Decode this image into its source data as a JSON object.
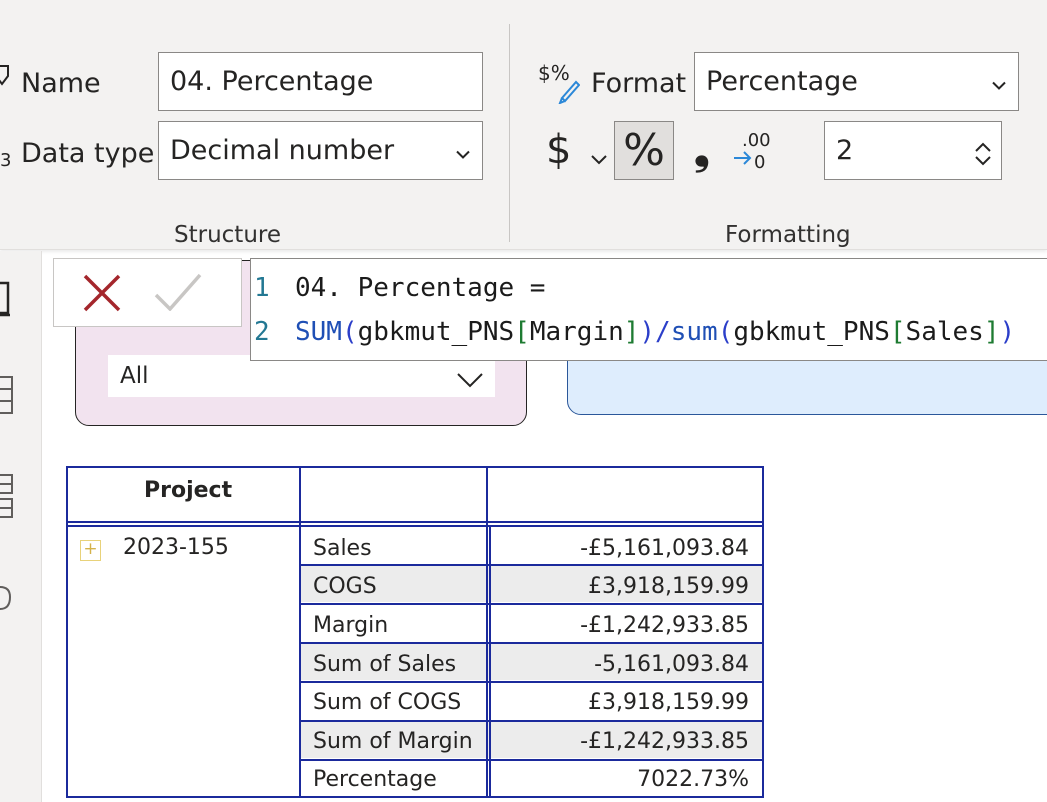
{
  "ribbon": {
    "structure": {
      "name_label": "Name",
      "name_value": "04. Percentage",
      "datatype_label": "Data type",
      "datatype_value": "Decimal number",
      "group_label": "Structure",
      "datatype_icon_glyph": "3"
    },
    "formatting": {
      "format_icon": "$%",
      "format_label": "Format",
      "format_value": "Percentage",
      "currency_symbol": "$",
      "percent_symbol": "%",
      "comma_symbol": "❟",
      "decimal_places": "2",
      "group_label": "Formatting"
    }
  },
  "slicer": {
    "selected_value": "All"
  },
  "formula": {
    "lines": [
      {
        "number": "1",
        "text": "04. Percentage ="
      },
      {
        "number": "2",
        "fn1": "SUM",
        "p1": "(",
        "arg1": "gbkmut_PNS",
        "b1": "[",
        "col1": "Margin",
        "b2": "]",
        "p2": ")",
        "div": ")/",
        "fn2": "sum",
        "p3": "(",
        "arg2": "gbkmut_PNS",
        "b3": "[",
        "col2": "Sales",
        "b4": "]",
        "p4": ")"
      }
    ]
  },
  "matrix": {
    "header": {
      "project": "Project",
      "col2": "",
      "col3": ""
    },
    "project_value": "2023-155",
    "rows": [
      {
        "label": "Sales",
        "value": "-£5,161,093.84"
      },
      {
        "label": "COGS",
        "value": "£3,918,159.99"
      },
      {
        "label": "Margin",
        "value": "-£1,242,933.85"
      },
      {
        "label": "Sum of Sales",
        "value": "-5,161,093.84"
      },
      {
        "label": "Sum of COGS",
        "value": "£3,918,159.99"
      },
      {
        "label": "Sum of Margin",
        "value": "-£1,242,933.85"
      },
      {
        "label": "Percentage",
        "value": "7022.73%"
      }
    ]
  },
  "colors": {
    "ribbon_bg": "#f3f2f1",
    "matrix_border": "#1b2a9c",
    "slicer_bg": "#f2e3ef",
    "card_bg": "#deedfd",
    "cancel_x": "#a4262c",
    "commit_check": "#c8c6c4"
  }
}
